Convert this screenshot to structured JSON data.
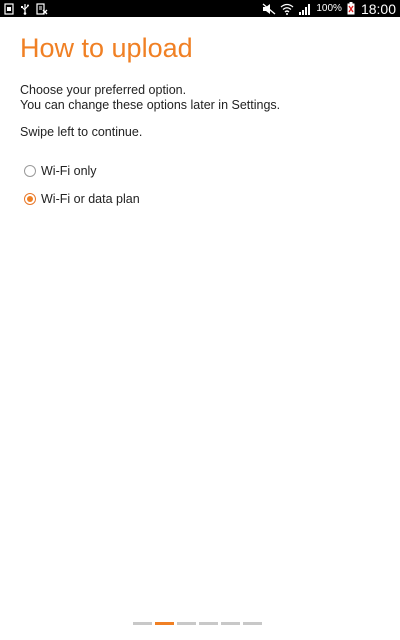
{
  "status_bar": {
    "battery_percent": "100%",
    "time": "18:00",
    "left_icons": [
      "screenshot-icon",
      "usb-icon",
      "file-icon"
    ],
    "right_icons": [
      "mute-icon",
      "wifi-icon",
      "signal-icon",
      "battery-icon"
    ]
  },
  "page": {
    "title": "How to upload",
    "description_line1": "Choose your preferred option.",
    "description_line2": "You can change these options later in Settings.",
    "swipe_hint": "Swipe left to continue."
  },
  "options": [
    {
      "label": "Wi-Fi only",
      "checked": false
    },
    {
      "label": "Wi-Fi or data plan",
      "checked": true
    }
  ],
  "pager": {
    "total": 6,
    "current": 2
  },
  "colors": {
    "accent": "#f08024",
    "text": "#222222",
    "status_bar": "#000000"
  }
}
